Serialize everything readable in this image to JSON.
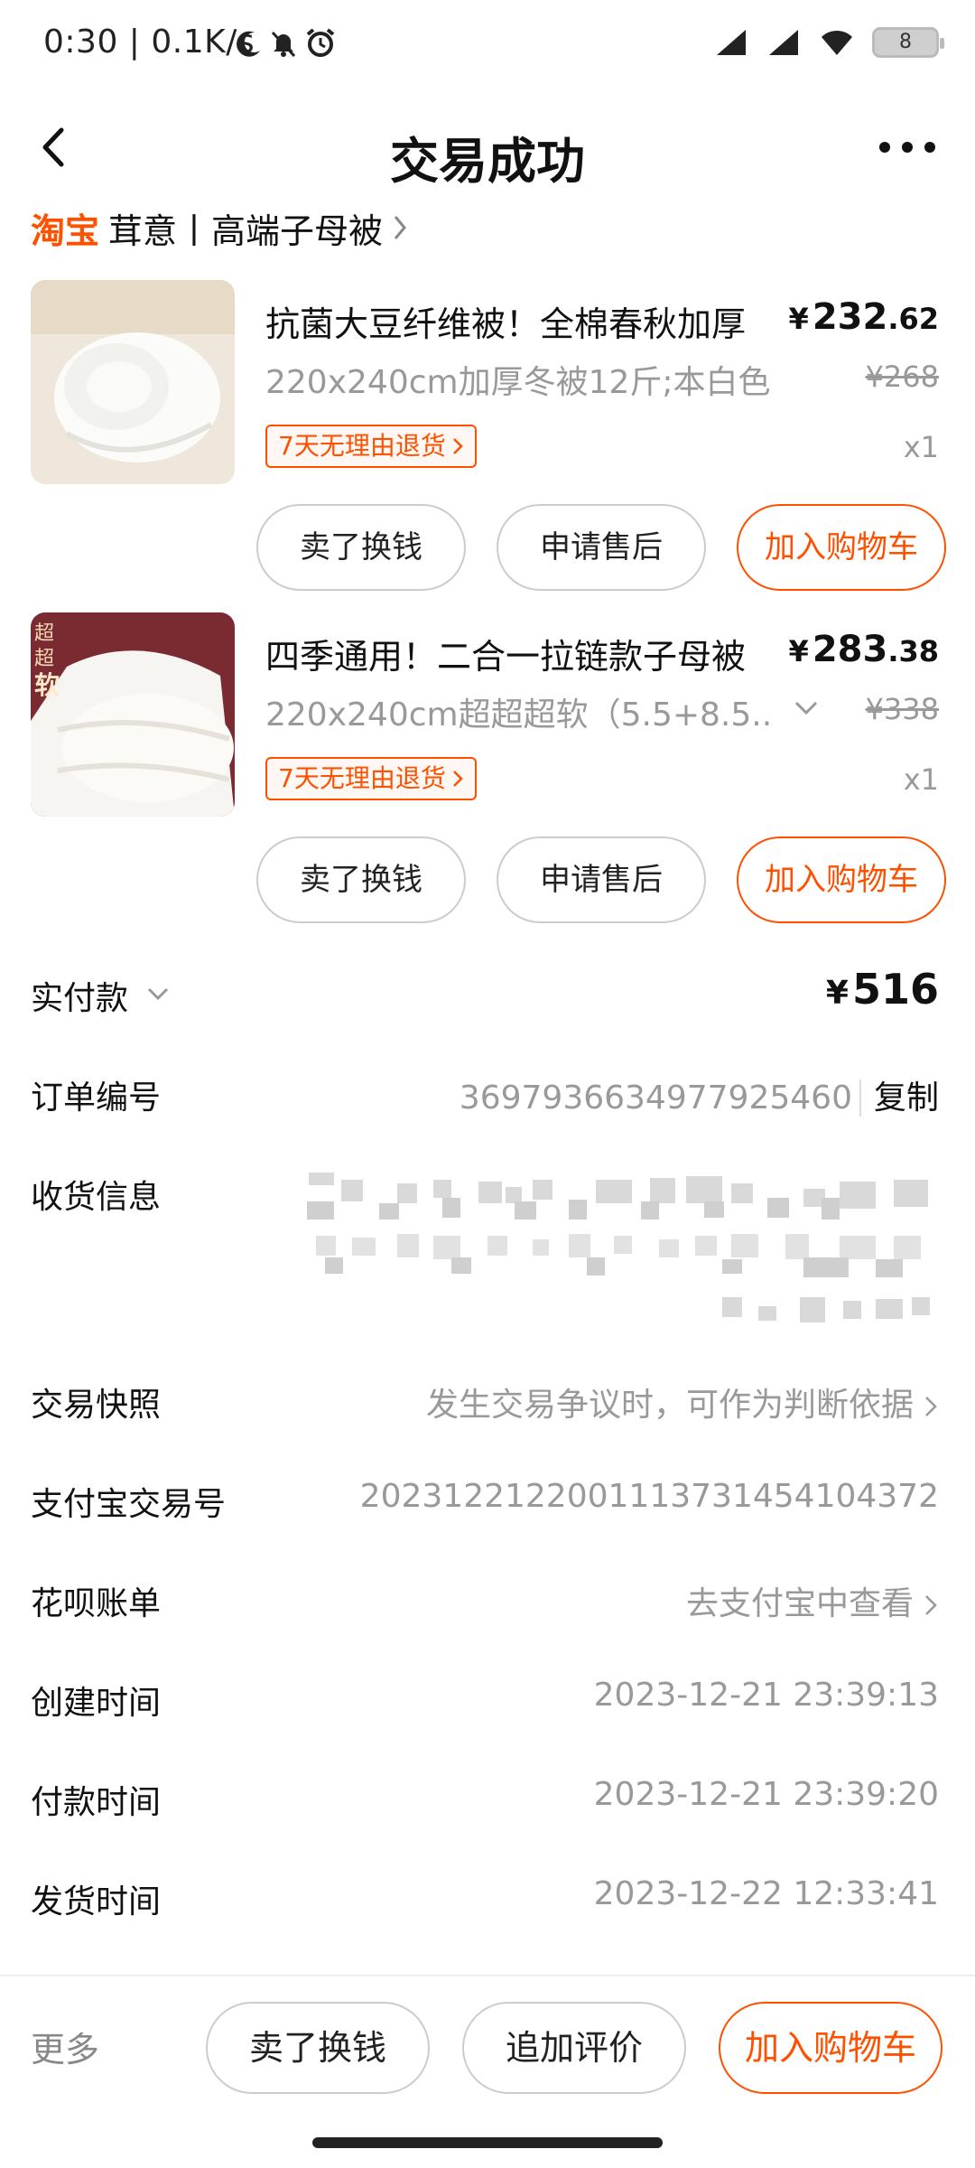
{
  "status_bar": {
    "text": "0:30 | 0.1K/s",
    "battery": "8"
  },
  "nav": {
    "title": "交易成功"
  },
  "shop": {
    "platform": "淘宝",
    "name": "茸意丨高端子母被"
  },
  "products": [
    {
      "title": "抗菌大豆纤维被！全棉春秋加厚",
      "price_symbol": "¥",
      "price_int": "232",
      "price_dec": ".62",
      "spec": "220x240cm加厚冬被12斤;本白色",
      "original_price": "¥268",
      "badge": "7天无理由退货",
      "qty": "x1",
      "buttons": [
        "卖了换钱",
        "申请售后",
        "加入购物车"
      ],
      "image_label": ""
    },
    {
      "title": "四季通用！二合一拉链款子母被",
      "price_symbol": "¥",
      "price_int": "283",
      "price_dec": ".38",
      "spec": "220x240cm超超超软（5.5+8.5...",
      "original_price": "¥338",
      "badge": "7天无理由退货",
      "qty": "x1",
      "buttons": [
        "卖了换钱",
        "申请售后",
        "加入购物车"
      ],
      "image_label": "超超软"
    }
  ],
  "details": {
    "paid": {
      "label": "实付款",
      "symbol": "¥",
      "amount": "516"
    },
    "order_no": {
      "label": "订单编号",
      "value": "3697936634977925460",
      "copy": "复制"
    },
    "shipping": {
      "label": "收货信息"
    },
    "snapshot": {
      "label": "交易快照",
      "value": "发生交易争议时，可作为判断依据"
    },
    "alipay_no": {
      "label": "支付宝交易号",
      "value": "2023122122001113731454104372"
    },
    "huabei": {
      "label": "花呗账单",
      "value": "去支付宝中查看"
    },
    "created": {
      "label": "创建时间",
      "value": "2023-12-21 23:39:13"
    },
    "paid_time": {
      "label": "付款时间",
      "value": "2023-12-21 23:39:20"
    },
    "shipped": {
      "label": "发货时间",
      "value": "2023-12-22 12:33:41"
    }
  },
  "bottom_bar": {
    "more": "更多",
    "buttons": [
      "卖了换钱",
      "追加评价",
      "加入购物车"
    ]
  },
  "colors": {
    "accent": "#ff5000",
    "text": "#111111",
    "muted": "#999999"
  }
}
